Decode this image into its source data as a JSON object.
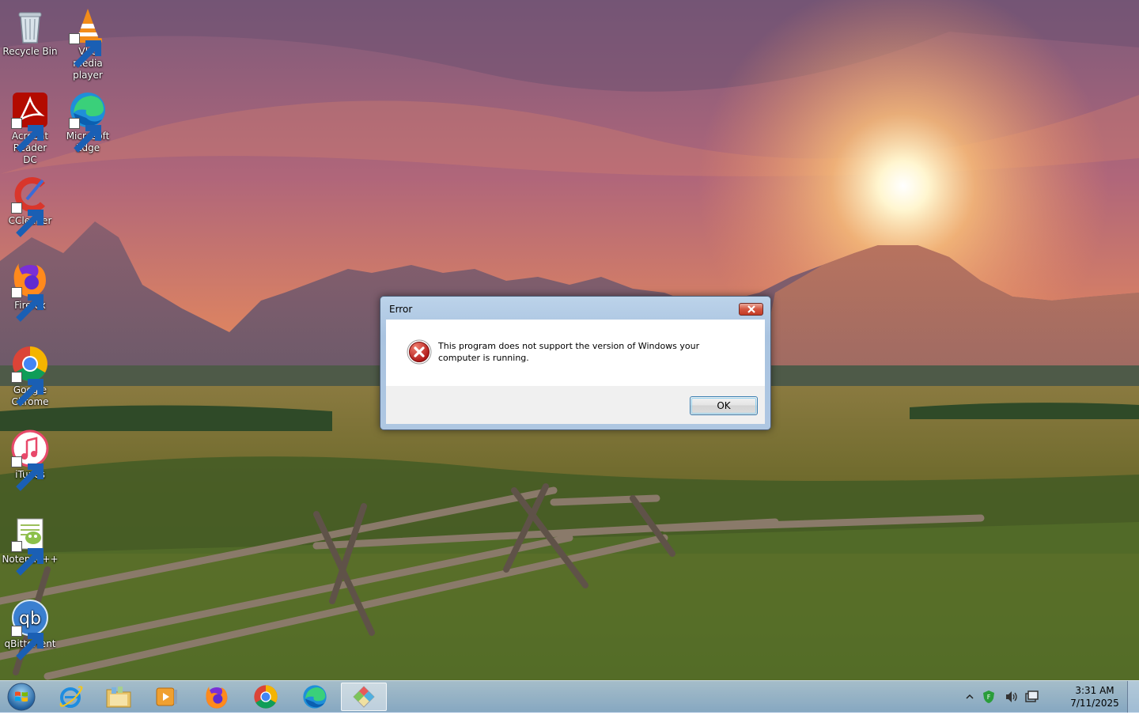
{
  "desktop": {
    "icons": [
      {
        "label": "Recycle Bin",
        "icon": "recycle-bin-icon"
      },
      {
        "label": "VLC media player",
        "icon": "vlc-icon"
      },
      {
        "label": "Acrobat Reader DC",
        "icon": "acrobat-icon"
      },
      {
        "label": "Microsoft Edge",
        "icon": "edge-icon"
      },
      {
        "label": "CCleaner",
        "icon": "ccleaner-icon"
      },
      {
        "label": "Firefox",
        "icon": "firefox-icon"
      },
      {
        "label": "Google Chrome",
        "icon": "chrome-icon"
      },
      {
        "label": "iTunes",
        "icon": "itunes-icon"
      },
      {
        "label": "Notepad++",
        "icon": "notepadpp-icon"
      },
      {
        "label": "qBittorrent",
        "icon": "qbittorrent-icon"
      }
    ]
  },
  "dialog": {
    "title": "Error",
    "message": "This program does not support the version of Windows your computer is running.",
    "ok_label": "OK",
    "icon": "error-icon"
  },
  "taskbar": {
    "start_icon": "windows-start-icon",
    "pinned": [
      {
        "icon": "internet-explorer-icon"
      },
      {
        "icon": "file-explorer-icon"
      },
      {
        "icon": "media-player-icon"
      },
      {
        "icon": "firefox-icon"
      },
      {
        "icon": "chrome-icon"
      },
      {
        "icon": "edge-icon"
      },
      {
        "icon": "installer-app-icon",
        "active": true
      }
    ],
    "tray": {
      "icons": [
        "show-hidden-icons-chevron",
        "security-shield-icon",
        "volume-icon",
        "action-center-icon"
      ],
      "time": "3:31 AM",
      "date": "7/11/2025"
    }
  }
}
